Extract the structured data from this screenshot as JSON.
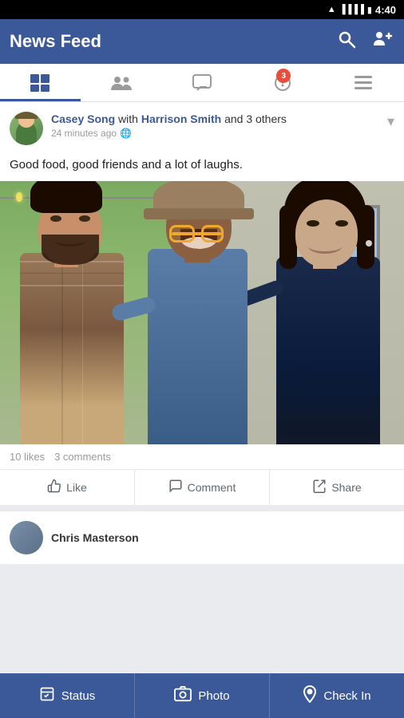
{
  "statusBar": {
    "time": "4:40",
    "wifi": "wifi",
    "signal": "signal",
    "battery": "battery"
  },
  "topNav": {
    "title": "News Feed",
    "searchLabel": "search",
    "friendsLabel": "friends"
  },
  "tabs": [
    {
      "id": "news-feed",
      "icon": "⊞",
      "active": true,
      "badge": null
    },
    {
      "id": "friends",
      "icon": "👥",
      "active": false,
      "badge": null
    },
    {
      "id": "messages",
      "icon": "💬",
      "active": false,
      "badge": null
    },
    {
      "id": "notifications",
      "icon": "🌐",
      "active": false,
      "badge": 3
    },
    {
      "id": "menu",
      "icon": "≡",
      "active": false,
      "badge": null
    }
  ],
  "post": {
    "author": "Casey Song",
    "withText": " with ",
    "coAuthor": "Harrison Smith",
    "andText": " and ",
    "othersText": "3 others",
    "timestamp": "24 minutes ago",
    "text": "Good food, good friends and a lot of laughs.",
    "likesCount": "10 likes",
    "commentsCount": "3 comments",
    "likeLabel": "Like",
    "commentLabel": "Comment",
    "shareLabel": "Share"
  },
  "nextPost": {
    "name": "Chris Masterson"
  },
  "bottomBar": {
    "statusLabel": "Status",
    "photoLabel": "Photo",
    "checkinLabel": "Check In"
  }
}
